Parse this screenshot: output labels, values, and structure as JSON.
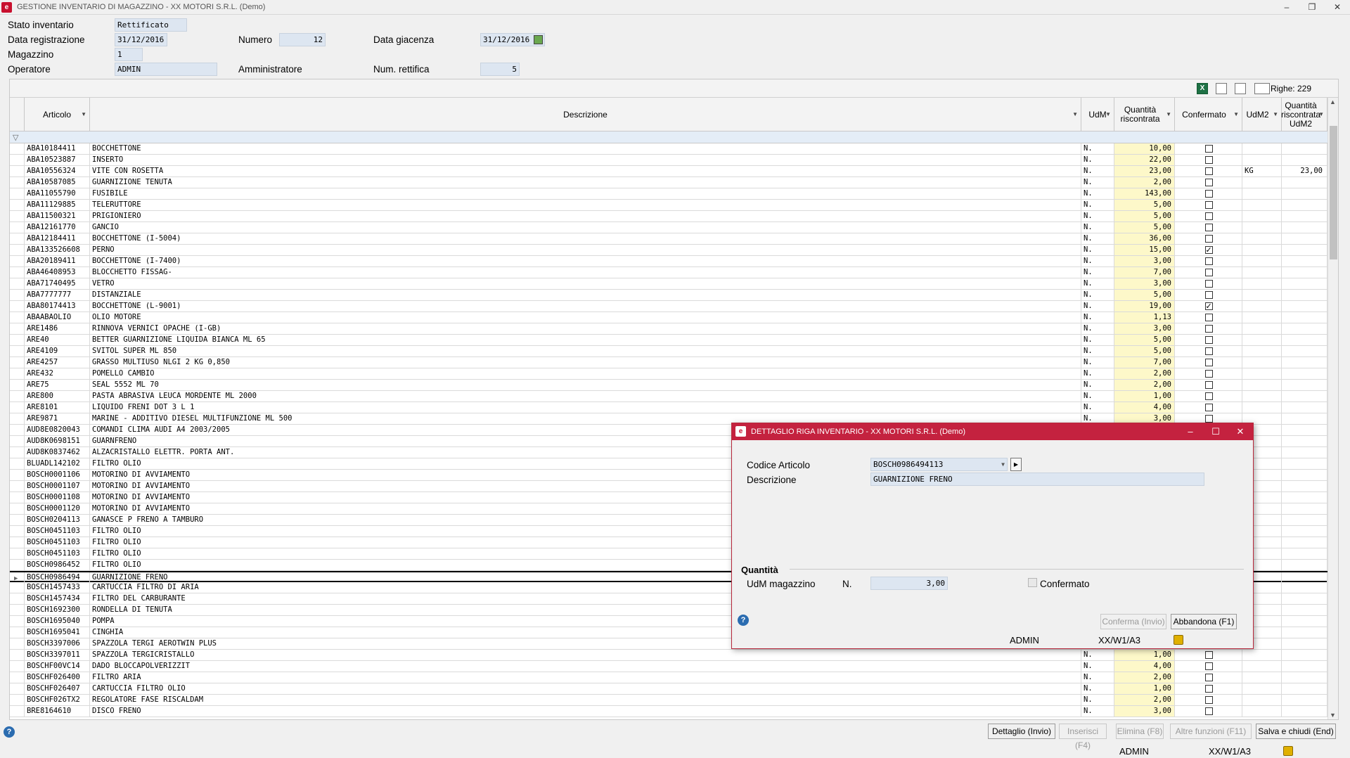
{
  "window": {
    "title": "GESTIONE INVENTARIO DI MAGAZZINO - XX  MOTORI S.R.L.  (Demo)"
  },
  "header": {
    "stato_label": "Stato inventario",
    "stato_value": "Rettificato",
    "data_reg_label": "Data registrazione",
    "data_reg_value": "31/12/2016",
    "numero_label": "Numero",
    "numero_value": "12",
    "data_giac_label": "Data giacenza",
    "data_giac_value": "31/12/2016",
    "magazzino_label": "Magazzino",
    "magazzino_value": "1",
    "operatore_label": "Operatore",
    "operatore_value": "ADMIN",
    "operatore_name": "Amministratore",
    "rettifica_label": "Num. rettifica",
    "rettifica_value": "5"
  },
  "toolbar": {
    "righe": "Righe: 229"
  },
  "columns": {
    "articolo": "Articolo",
    "descrizione": "Descrizione",
    "udm": "UdM",
    "qty": "Quantità riscontrata",
    "confermato": "Confermato",
    "udm2": "UdM2",
    "qty2": "Quantità riscontrata UdM2"
  },
  "rows": [
    {
      "art": "ABA10184411",
      "desc": "BOCCHETTONE",
      "udm": "N.",
      "qty": "10,00",
      "conf": false,
      "udm2": "",
      "qty2": ""
    },
    {
      "art": "ABA10523887",
      "desc": "INSERTO",
      "udm": "N.",
      "qty": "22,00",
      "conf": false,
      "udm2": "",
      "qty2": ""
    },
    {
      "art": "ABA10556324",
      "desc": "VITE CON ROSETTA",
      "udm": "N.",
      "qty": "23,00",
      "conf": false,
      "udm2": "KG",
      "qty2": "23,00"
    },
    {
      "art": "ABA10587085",
      "desc": "GUARNIZIONE TENUTA",
      "udm": "N.",
      "qty": "2,00",
      "conf": false,
      "udm2": "",
      "qty2": ""
    },
    {
      "art": "ABA11055790",
      "desc": "FUSIBILE",
      "udm": "N.",
      "qty": "143,00",
      "conf": false,
      "udm2": "",
      "qty2": ""
    },
    {
      "art": "ABA11129885",
      "desc": "TELERUTTORE",
      "udm": "N.",
      "qty": "5,00",
      "conf": false,
      "udm2": "",
      "qty2": ""
    },
    {
      "art": "ABA11500321",
      "desc": "PRIGIONIERO",
      "udm": "N.",
      "qty": "5,00",
      "conf": false,
      "udm2": "",
      "qty2": ""
    },
    {
      "art": "ABA12161770",
      "desc": "GANCIO",
      "udm": "N.",
      "qty": "5,00",
      "conf": false,
      "udm2": "",
      "qty2": ""
    },
    {
      "art": "ABA12184411",
      "desc": "BOCCHETTONE (I-5004)",
      "udm": "N.",
      "qty": "36,00",
      "conf": false,
      "udm2": "",
      "qty2": ""
    },
    {
      "art": "ABA133526608",
      "desc": "PERNO",
      "udm": "N.",
      "qty": "15,00",
      "conf": true,
      "udm2": "",
      "qty2": ""
    },
    {
      "art": "ABA20189411",
      "desc": "BOCCHETTONE (I-7400)",
      "udm": "N.",
      "qty": "3,00",
      "conf": false,
      "udm2": "",
      "qty2": ""
    },
    {
      "art": "ABA46408953",
      "desc": "BLOCCHETTO FISSAG-",
      "udm": "N.",
      "qty": "7,00",
      "conf": false,
      "udm2": "",
      "qty2": ""
    },
    {
      "art": "ABA71740495",
      "desc": "VETRO",
      "udm": "N.",
      "qty": "3,00",
      "conf": false,
      "udm2": "",
      "qty2": ""
    },
    {
      "art": "ABA7777777",
      "desc": "DISTANZIALE",
      "udm": "N.",
      "qty": "5,00",
      "conf": false,
      "udm2": "",
      "qty2": ""
    },
    {
      "art": "ABA80174413",
      "desc": "BOCCHETTONE (L-9001)",
      "udm": "N.",
      "qty": "19,00",
      "conf": true,
      "udm2": "",
      "qty2": ""
    },
    {
      "art": "ABAABAOLIO",
      "desc": "OLIO MOTORE",
      "udm": "N.",
      "qty": "1,13",
      "conf": false,
      "udm2": "",
      "qty2": ""
    },
    {
      "art": "ARE1486",
      "desc": "RINNOVA VERNICI OPACHE (I-GB)",
      "udm": "N.",
      "qty": "3,00",
      "conf": false,
      "udm2": "",
      "qty2": ""
    },
    {
      "art": "ARE40",
      "desc": "BETTER GUARNIZIONE LIQUIDA BIANCA ML 65",
      "udm": "N.",
      "qty": "5,00",
      "conf": false,
      "udm2": "",
      "qty2": ""
    },
    {
      "art": "ARE4109",
      "desc": "SVITOL SUPER ML 850",
      "udm": "N.",
      "qty": "5,00",
      "conf": false,
      "udm2": "",
      "qty2": ""
    },
    {
      "art": "ARE4257",
      "desc": "GRASSO MULTIUSO NLGI 2 KG 0,850",
      "udm": "N.",
      "qty": "7,00",
      "conf": false,
      "udm2": "",
      "qty2": ""
    },
    {
      "art": "ARE432",
      "desc": "POMELLO CAMBIO",
      "udm": "N.",
      "qty": "2,00",
      "conf": false,
      "udm2": "",
      "qty2": ""
    },
    {
      "art": "ARE75",
      "desc": "SEAL 5552 ML 70",
      "udm": "N.",
      "qty": "2,00",
      "conf": false,
      "udm2": "",
      "qty2": ""
    },
    {
      "art": "ARE800",
      "desc": "PASTA ABRASIVA LEUCA MORDENTE ML 2000",
      "udm": "N.",
      "qty": "1,00",
      "conf": false,
      "udm2": "",
      "qty2": ""
    },
    {
      "art": "ARE8101",
      "desc": "LIQUIDO FRENI DOT 3 L 1",
      "udm": "N.",
      "qty": "4,00",
      "conf": false,
      "udm2": "",
      "qty2": ""
    },
    {
      "art": "ARE9871",
      "desc": "MARINE - ADDITIVO DIESEL MULTIFUNZIONE ML 500",
      "udm": "N.",
      "qty": "3,00",
      "conf": false,
      "udm2": "",
      "qty2": ""
    },
    {
      "art": "AUD8E0820043",
      "desc": "COMANDI CLIMA AUDI A4 2003/2005",
      "udm": "",
      "qty": "",
      "conf": null,
      "udm2": "",
      "qty2": ""
    },
    {
      "art": "AUD8K0698151",
      "desc": "GUARNFRENO",
      "udm": "",
      "qty": "",
      "conf": null,
      "udm2": "",
      "qty2": ""
    },
    {
      "art": "AUD8K0837462",
      "desc": "ALZACRISTALLO ELETTR. PORTA ANT.",
      "udm": "",
      "qty": "",
      "conf": null,
      "udm2": "",
      "qty2": ""
    },
    {
      "art": "BLUADL142102",
      "desc": "FILTRO OLIO",
      "udm": "",
      "qty": "",
      "conf": null,
      "udm2": "",
      "qty2": ""
    },
    {
      "art": "BOSCH0001106",
      "desc": "MOTORINO DI AVVIAMENTO",
      "udm": "",
      "qty": "",
      "conf": null,
      "udm2": "",
      "qty2": ""
    },
    {
      "art": "BOSCH0001107",
      "desc": "MOTORINO DI AVVIAMENTO",
      "udm": "",
      "qty": "",
      "conf": null,
      "udm2": "",
      "qty2": ""
    },
    {
      "art": "BOSCH0001108",
      "desc": "MOTORINO DI AVVIAMENTO",
      "udm": "",
      "qty": "",
      "conf": null,
      "udm2": "",
      "qty2": ""
    },
    {
      "art": "BOSCH0001120",
      "desc": "MOTORINO DI AVVIAMENTO",
      "udm": "",
      "qty": "",
      "conf": null,
      "udm2": "",
      "qty2": ""
    },
    {
      "art": "BOSCH0204113",
      "desc": "GANASCE P FRENO A TAMBURO",
      "udm": "",
      "qty": "",
      "conf": null,
      "udm2": "",
      "qty2": ""
    },
    {
      "art": "BOSCH0451103",
      "desc": "FILTRO OLIO",
      "udm": "",
      "qty": "",
      "conf": null,
      "udm2": "",
      "qty2": ""
    },
    {
      "art": "BOSCH0451103",
      "desc": "FILTRO OLIO",
      "udm": "",
      "qty": "",
      "conf": null,
      "udm2": "",
      "qty2": ""
    },
    {
      "art": "BOSCH0451103",
      "desc": "FILTRO OLIO",
      "udm": "",
      "qty": "",
      "conf": null,
      "udm2": "",
      "qty2": ""
    },
    {
      "art": "BOSCH0986452",
      "desc": "FILTRO OLIO",
      "udm": "",
      "qty": "",
      "conf": null,
      "udm2": "",
      "qty2": ""
    },
    {
      "art": "BOSCH0986494",
      "desc": "GUARNIZIONE FRENO",
      "udm": "",
      "qty": "",
      "conf": null,
      "udm2": "",
      "qty2": "",
      "cur": true
    },
    {
      "art": "BOSCH1457433",
      "desc": "CARTUCCIA FILTRO DI ARIA",
      "udm": "",
      "qty": "",
      "conf": null,
      "udm2": "",
      "qty2": ""
    },
    {
      "art": "BOSCH1457434",
      "desc": "FILTRO DEL CARBURANTE",
      "udm": "",
      "qty": "",
      "conf": null,
      "udm2": "",
      "qty2": ""
    },
    {
      "art": "BOSCH1692300",
      "desc": "RONDELLA DI TENUTA",
      "udm": "",
      "qty": "",
      "conf": null,
      "udm2": "",
      "qty2": ""
    },
    {
      "art": "BOSCH1695040",
      "desc": "POMPA",
      "udm": "",
      "qty": "",
      "conf": null,
      "udm2": "",
      "qty2": ""
    },
    {
      "art": "BOSCH1695041",
      "desc": "CINGHIA",
      "udm": "",
      "qty": "",
      "conf": null,
      "udm2": "",
      "qty2": ""
    },
    {
      "art": "BOSCH3397006",
      "desc": "SPAZZOLA TERGI AEROTWIN PLUS",
      "udm": "",
      "qty": "",
      "conf": null,
      "udm2": "",
      "qty2": ""
    },
    {
      "art": "BOSCH3397011",
      "desc": "SPAZZOLA TERGICRISTALLO",
      "udm": "N.",
      "qty": "1,00",
      "conf": false,
      "udm2": "",
      "qty2": ""
    },
    {
      "art": "BOSCHF00VC14",
      "desc": "DADO BLOCCAPOLVERIZZIT",
      "udm": "N.",
      "qty": "4,00",
      "conf": false,
      "udm2": "",
      "qty2": ""
    },
    {
      "art": "BOSCHF026400",
      "desc": "FILTRO ARIA",
      "udm": "N.",
      "qty": "2,00",
      "conf": false,
      "udm2": "",
      "qty2": ""
    },
    {
      "art": "BOSCHF026407",
      "desc": "CARTUCCIA FILTRO OLIO",
      "udm": "N.",
      "qty": "1,00",
      "conf": false,
      "udm2": "",
      "qty2": ""
    },
    {
      "art": "BOSCHF026TX2",
      "desc": "REGOLATORE FASE RISCALDAM",
      "udm": "N.",
      "qty": "2,00",
      "conf": false,
      "udm2": "",
      "qty2": ""
    },
    {
      "art": "BRE8164610",
      "desc": "DISCO FRENO",
      "udm": "N.",
      "qty": "3,00",
      "conf": false,
      "udm2": "",
      "qty2": ""
    }
  ],
  "buttons": {
    "dettaglio": "Dettaglio (Invio)",
    "inserisci": "Inserisci (F4)",
    "elimina": "Elimina (F8)",
    "altre": "Altre funzioni (F11)",
    "salva": "Salva e chiudi (End)"
  },
  "status": {
    "user": "ADMIN",
    "path": "XX/W1/A3"
  },
  "dialog": {
    "title": "DETTAGLIO RIGA INVENTARIO - XX  MOTORI S.R.L.  (Demo)",
    "codice_label": "Codice Articolo",
    "codice_value": "BOSCH0986494113",
    "descr_label": "Descrizione",
    "descr_value": "GUARNIZIONE FRENO",
    "section": "Quantità",
    "udm_label": "UdM magazzino",
    "udm_value": "N.",
    "qty_value": "3,00",
    "confermato_label": "Confermato",
    "conferma_btn": "Conferma (Invio)",
    "abbandona_btn": "Abbandona (F1)",
    "user": "ADMIN",
    "path": "XX/W1/A3"
  }
}
